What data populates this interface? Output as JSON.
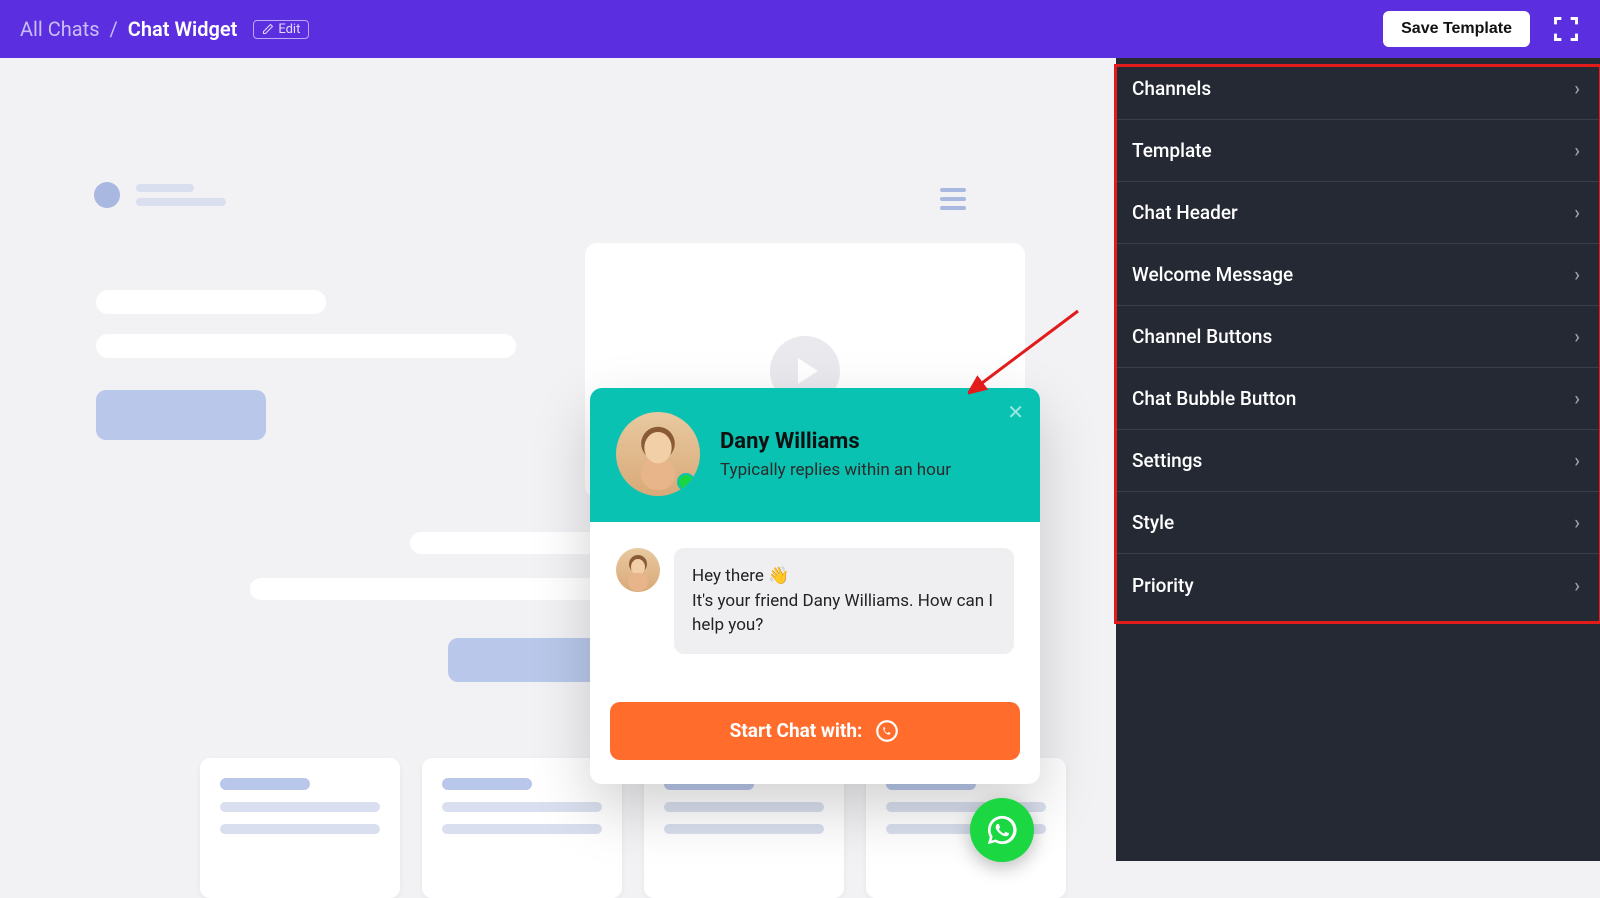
{
  "breadcrumb": {
    "root": "All Chats",
    "current": "Chat Widget",
    "edit_label": "Edit"
  },
  "header": {
    "save_label": "Save Template"
  },
  "panel": {
    "items": [
      {
        "label": "Channels"
      },
      {
        "label": "Template"
      },
      {
        "label": "Chat Header"
      },
      {
        "label": "Welcome Message"
      },
      {
        "label": "Channel Buttons"
      },
      {
        "label": "Chat Bubble Button"
      },
      {
        "label": "Settings"
      },
      {
        "label": "Style"
      },
      {
        "label": "Priority"
      }
    ]
  },
  "widget": {
    "agent_name": "Dany Williams",
    "status_text": "Typically replies within an hour",
    "message_text": "Hey there 👋\nIt's your friend Dany Williams. How can I help you?",
    "cta_label": "Start Chat with:"
  }
}
